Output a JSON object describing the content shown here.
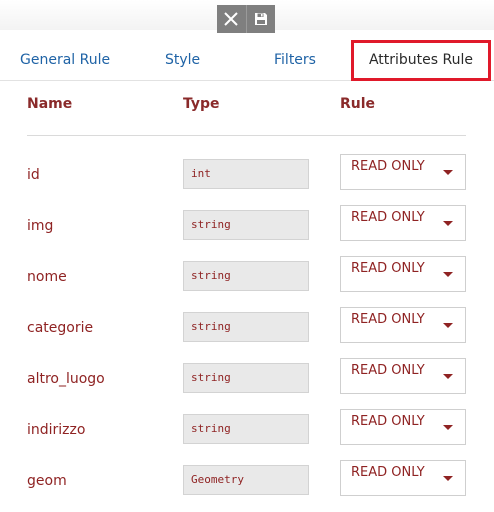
{
  "toolbar": {
    "close_icon": "close-icon",
    "save_icon": "floppy-disk-icon"
  },
  "tabs": [
    {
      "label": "General Rule"
    },
    {
      "label": "Style"
    },
    {
      "label": "Filters"
    },
    {
      "label": "Attributes Rule",
      "active": true
    }
  ],
  "columns": {
    "name": "Name",
    "type": "Type",
    "rule": "Rule"
  },
  "attributes": [
    {
      "name": "id",
      "type": "int",
      "rule": "READ ONLY"
    },
    {
      "name": "img",
      "type": "string",
      "rule": "READ ONLY"
    },
    {
      "name": "nome",
      "type": "string",
      "rule": "READ ONLY"
    },
    {
      "name": "categorie",
      "type": "string",
      "rule": "READ ONLY"
    },
    {
      "name": "altro_luogo",
      "type": "string",
      "rule": "READ ONLY"
    },
    {
      "name": "indirizzo",
      "type": "string",
      "rule": "READ ONLY"
    },
    {
      "name": "geom",
      "type": "Geometry",
      "rule": "READ ONLY"
    }
  ],
  "colors": {
    "accent": "#e0192a",
    "text_red": "#8f2323",
    "link_blue": "#1f63a6",
    "toolbar_gray": "#7f7f7f"
  }
}
